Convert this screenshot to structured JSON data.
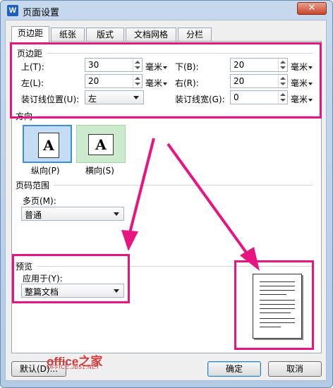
{
  "window": {
    "title": "页面设置",
    "app_icon_letter": "W",
    "close_symbol": "✕"
  },
  "tabs": [
    {
      "label": "页边距",
      "active": true
    },
    {
      "label": "纸张",
      "active": false
    },
    {
      "label": "版式",
      "active": false
    },
    {
      "label": "文档网格",
      "active": false
    },
    {
      "label": "分栏",
      "active": false
    }
  ],
  "margins": {
    "section_title": "页边距",
    "top": {
      "label": "上(T):",
      "value": "30",
      "unit": "毫米"
    },
    "bottom": {
      "label": "下(B):",
      "value": "20",
      "unit": "毫米"
    },
    "left": {
      "label": "左(L):",
      "value": "20",
      "unit": "毫米"
    },
    "right": {
      "label": "右(R):",
      "value": "20",
      "unit": "毫米"
    },
    "gutter_position": {
      "label": "装订线位置(U):",
      "value": "左"
    },
    "gutter_width": {
      "label": "装订线宽(G):",
      "value": "0",
      "unit": "毫米"
    }
  },
  "orientation": {
    "section_title": "方向",
    "portrait": {
      "label": "纵向(P)",
      "glyph": "A",
      "selected": true
    },
    "landscape": {
      "label": "横向(S)",
      "glyph": "A",
      "selected": false
    }
  },
  "page_range": {
    "section_title": "页码范围",
    "multiple_pages_label": "多页(M):",
    "multiple_pages_value": "普通"
  },
  "preview": {
    "section_title": "预览",
    "apply_to_label": "应用于(Y):",
    "apply_to_value": "整篇文档"
  },
  "buttons": {
    "default": "默认(D)...",
    "ok": "确定",
    "cancel": "取消"
  },
  "watermark": {
    "main": "office之家",
    "sub": "OFFICE.JB51.NET"
  },
  "colors": {
    "highlight": "#e6157f",
    "title_bar": "#c7d9ee",
    "portrait_selected": "#c5ddf4",
    "landscape": "#cdeacf"
  }
}
